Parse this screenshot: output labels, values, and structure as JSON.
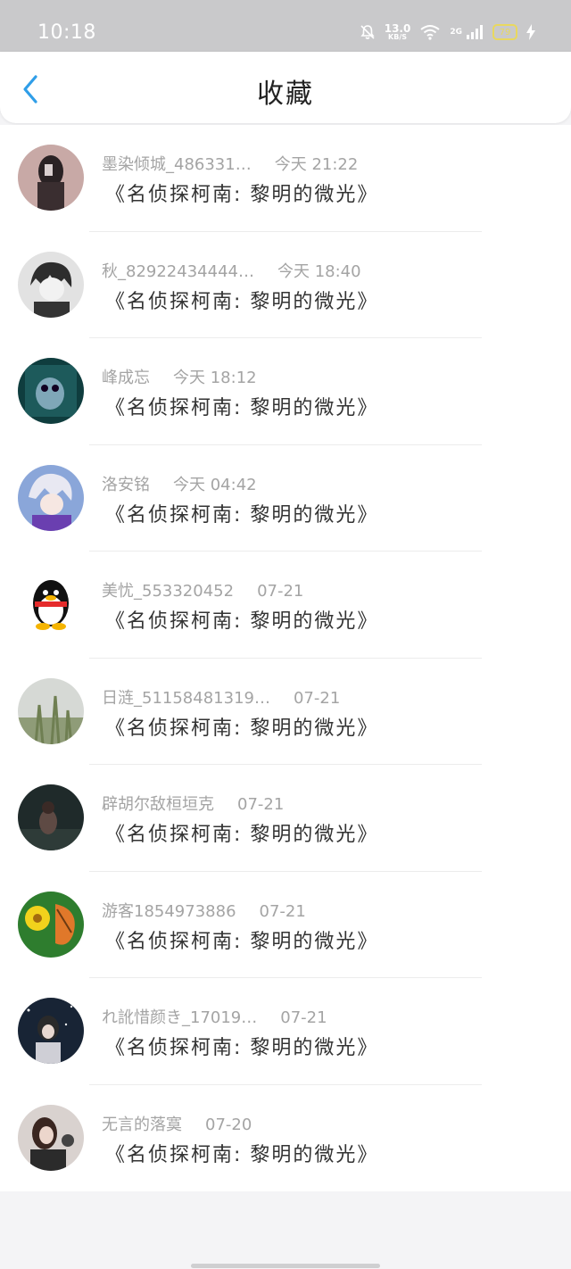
{
  "status_bar": {
    "time": "10:18",
    "net_speed": "13.0",
    "net_unit": "KB/S",
    "signal_label": "2G",
    "battery": "79",
    "icons": [
      "bell-mute-icon",
      "wifi-icon",
      "signal-icon",
      "battery-icon",
      "charging-icon"
    ]
  },
  "header": {
    "title": "收藏",
    "back_icon": "chevron-left-icon"
  },
  "items": [
    {
      "name": "墨染倾城_486331…",
      "time": "今天 21:22",
      "work": "《名侦探柯南: 黎明的微光》"
    },
    {
      "name": "秋_82922434444…",
      "time": "今天 18:40",
      "work": "《名侦探柯南: 黎明的微光》"
    },
    {
      "name": "峰成忘",
      "time": "今天 18:12",
      "work": "《名侦探柯南: 黎明的微光》"
    },
    {
      "name": "洛安铭",
      "time": "今天 04:42",
      "work": "《名侦探柯南: 黎明的微光》"
    },
    {
      "name": "美忧_553320452",
      "time": "07-21",
      "work": "《名侦探柯南: 黎明的微光》"
    },
    {
      "name": "日涟_51158481319…",
      "time": "07-21",
      "work": "《名侦探柯南: 黎明的微光》"
    },
    {
      "name": "辟胡尔敌桓垣克",
      "time": "07-21",
      "work": "《名侦探柯南: 黎明的微光》"
    },
    {
      "name": "游客1854973886",
      "time": "07-21",
      "work": "《名侦探柯南: 黎明的微光》"
    },
    {
      "name": "れ訛惜颜き_17019…",
      "time": "07-21",
      "work": "《名侦探柯南: 黎明的微光》"
    },
    {
      "name": "无言的落寞",
      "time": "07-20",
      "work": "《名侦探柯南: 黎明的微光》"
    }
  ],
  "colors": {
    "accent": "#2f9ee8",
    "status_bar": "#c9c9cb",
    "meta_text": "#a4a4a4",
    "work_text": "#333333"
  }
}
